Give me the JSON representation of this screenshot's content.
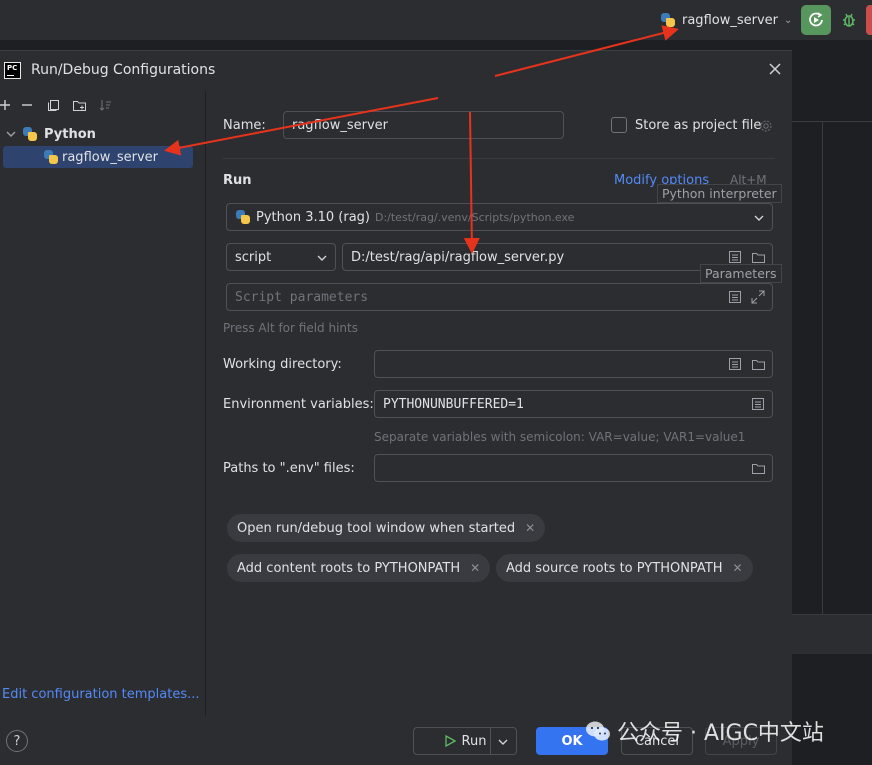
{
  "topbar": {
    "run_config": "ragflow_server"
  },
  "dialog": {
    "title": "Run/Debug Configurations",
    "logo_text": "PC",
    "tree": {
      "group": "Python",
      "item": "ragflow_server"
    },
    "edit_templates": "Edit configuration templates...",
    "name_label": "Name:",
    "name_value": "ragflow_server",
    "store_label": "Store as project file",
    "run_section": "Run",
    "modify_options": "Modify options",
    "modify_shortcut": "Alt+M",
    "tooltip_interpreter": "Python interpreter",
    "interpreter": "Python 3.10 (rag)",
    "interpreter_path": "D:/test/rag/.venv/Scripts/python.exe",
    "script_type": "script",
    "script_path": "D:/test/rag/api/ragflow_server.py",
    "tooltip_parameters": "Parameters",
    "script_params_placeholder": "Script parameters",
    "alt_hint": "Press Alt for field hints",
    "working_dir_label": "Working directory:",
    "working_dir_value": "",
    "env_label": "Environment variables:",
    "env_value": "PYTHONUNBUFFERED=1",
    "env_hint": "Separate variables with semicolon: VAR=value; VAR1=value1",
    "dotenv_label": "Paths to \".env\" files:",
    "dotenv_value": "",
    "tags": [
      "Open run/debug tool window when started",
      "Add content roots to PYTHONPATH",
      "Add source roots to PYTHONPATH"
    ],
    "buttons": {
      "help": "?",
      "run": "Run",
      "ok": "OK",
      "cancel": "Cancel",
      "apply": "Apply"
    }
  },
  "watermark": "公众号 · AIGC中文站",
  "colors": {
    "accent": "#3574f0",
    "link": "#548af7",
    "selection": "#2e436e",
    "arrow": "#e8331c",
    "run_green": "#57965c"
  }
}
